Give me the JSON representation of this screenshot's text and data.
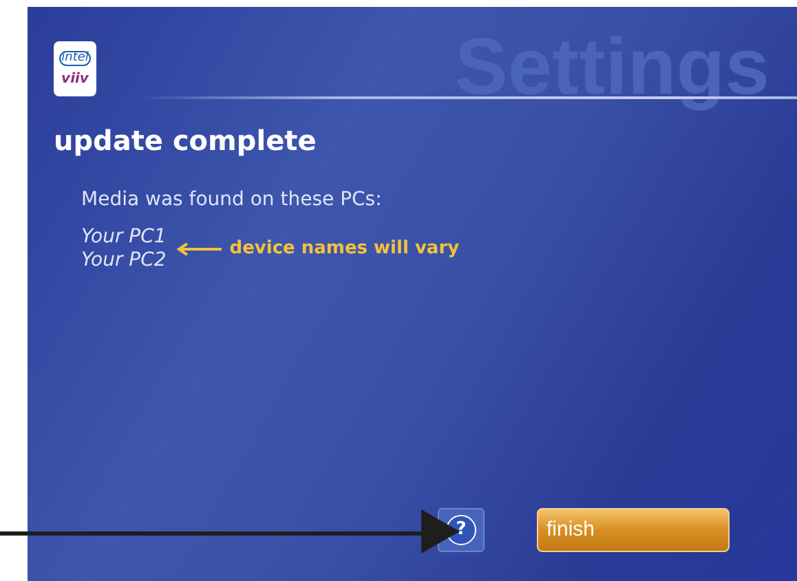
{
  "logo": {
    "top": "intel",
    "bottom": "viiv"
  },
  "header": {
    "title": "Settings"
  },
  "page_title": "update complete",
  "message": "Media was found on these PCs:",
  "devices": [
    "Your PC1",
    "Your PC2"
  ],
  "annotation": {
    "text": "device names will vary"
  },
  "buttons": [
    {
      "kind": "help",
      "label": "?"
    },
    {
      "kind": "primary",
      "label": "finish"
    }
  ]
}
